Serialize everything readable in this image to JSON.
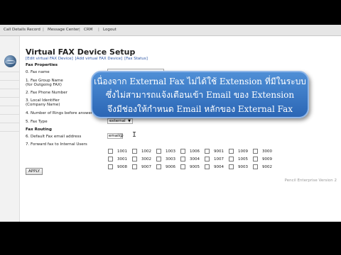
{
  "topnav": {
    "items": [
      "Call Details Record",
      "Message Center",
      "CRM",
      "Logout"
    ],
    "separator": "|"
  },
  "page": {
    "title": "Virtual FAX Device Setup",
    "links": [
      "[Edit virtual FAX Device]",
      "[Add virtual FAX Device]",
      "[Fax Status]"
    ]
  },
  "form": {
    "fax_properties": "Fax Properties",
    "fax_name": "0. Fax name",
    "fax_group_name_1": "1. Fax Group Name",
    "fax_group_name_2": "(for Outgoing FAX)",
    "fax_phone_number": "2. Fax Phone Number",
    "local_identifier_1": "3. Local Identifier",
    "local_identifier_2": "(Company Name)",
    "rings_before_answer": "4. Number of Rings before answer",
    "fax_type": "5. Fax Type",
    "fax_type_value": "external",
    "fax_routing": "Fax Routing",
    "default_email_label": "6. Default Fax email address",
    "default_email_value": "email@",
    "forward_label": "7. Forward fax to Internal Users",
    "apply": "APPLY"
  },
  "extensions": [
    [
      "1001",
      "1002",
      "1003",
      "1006",
      "9001",
      "1009",
      "3000"
    ],
    [
      "3001",
      "3002",
      "3003",
      "3004",
      "1007",
      "1005",
      "9009"
    ],
    [
      "9008",
      "9007",
      "9006",
      "9005",
      "9004",
      "9003",
      "9002"
    ]
  ],
  "footer": "Pencil Enterprise Version 2",
  "overlay": {
    "line1": "เนื่องจาก External Fax ไม่ได้ใช้ Extension ที่มีในระบบ",
    "line2": "ซึ่งไม่สามารถแจ้งเตือนเข้า Email ของ Extension",
    "line3": "จึงมีช่องให้กำหนด Email หลักของ External Fax"
  }
}
